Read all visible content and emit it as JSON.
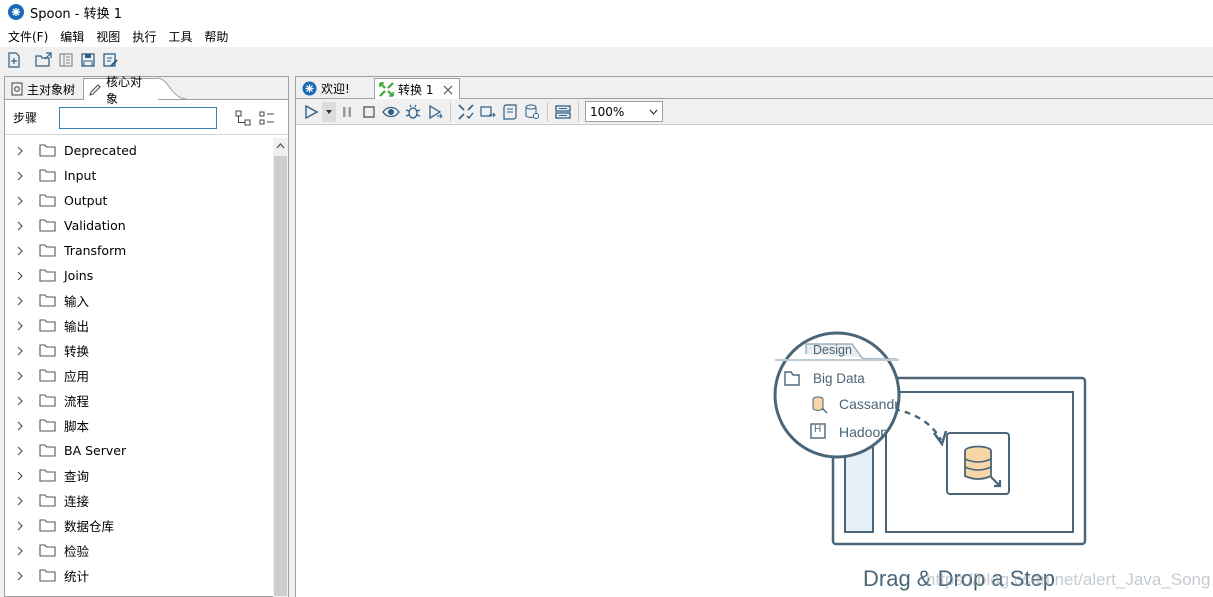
{
  "window": {
    "title": "Spoon - 转换 1"
  },
  "menu": [
    "文件(F)",
    "编辑",
    "视图",
    "执行",
    "工具",
    "帮助"
  ],
  "left_panel": {
    "tabs": [
      {
        "label": "主对象树",
        "icon": "tree-icon",
        "active": false
      },
      {
        "label": "核心对象",
        "icon": "pencil-icon",
        "active": true
      }
    ],
    "steps_label": "步骤",
    "search_value": "",
    "tree_items": [
      "Deprecated",
      "Input",
      "Output",
      "Validation",
      "Transform",
      "Joins",
      "输入",
      "输出",
      "转换",
      "应用",
      "流程",
      "脚本",
      "BA Server",
      "查询",
      "连接",
      "数据仓库",
      "检验",
      "统计"
    ]
  },
  "right_panel": {
    "tabs": [
      {
        "label": "欢迎!",
        "icon": "spoon-icon",
        "active": false
      },
      {
        "label": "转换 1",
        "icon": "transformation-icon",
        "active": true,
        "closable": true
      }
    ],
    "zoom": "100%",
    "canvas": {
      "design_tab": "Design",
      "folder": "Big Data",
      "items": [
        "Cassandra",
        "Hadoop"
      ],
      "hadoop_badge": "H",
      "headline": "Drag & Drop a Step",
      "watermark": "https://blog.csdn.net/alert_Java_Song"
    }
  },
  "colors": {
    "accent": "#1b6ab5",
    "illustration": "#4a6578",
    "transform_icon": "#3aaa35"
  }
}
